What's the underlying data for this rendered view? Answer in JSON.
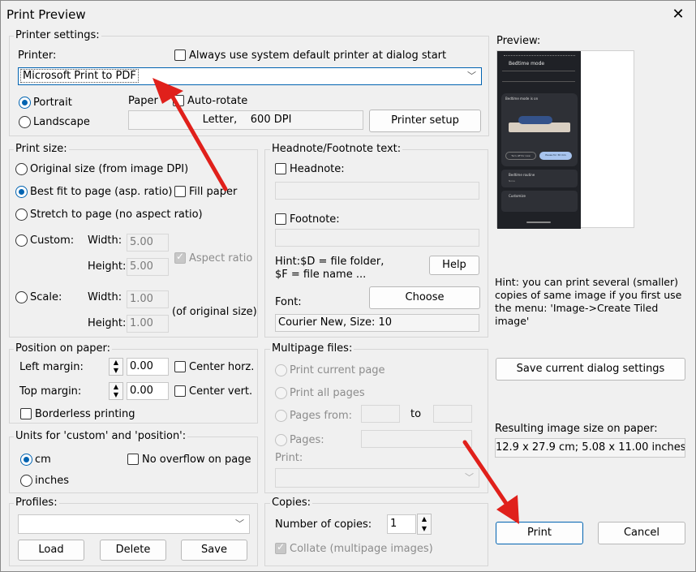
{
  "window": {
    "title": "Print Preview",
    "close_glyph": "✕"
  },
  "printer_settings": {
    "group_label": "Printer settings:",
    "printer_label": "Printer:",
    "always_default_label": "Always use system default printer at dialog start",
    "printer_value": "Microsoft Print to PDF",
    "portrait_label": "Portrait",
    "landscape_label": "Landscape",
    "paper_label": "Paper",
    "auto_rotate_label": "Auto-rotate",
    "paper_value": "Letter,    600 DPI",
    "printer_setup_label": "Printer setup"
  },
  "print_size": {
    "group_label": "Print size:",
    "original_label": "Original size (from image DPI)",
    "best_fit_label": "Best fit to page (asp. ratio)",
    "fill_paper_label": "Fill paper",
    "stretch_label": "Stretch to page (no aspect ratio)",
    "custom_label": "Custom:",
    "width_label": "Width:",
    "height_label": "Height:",
    "custom_width": "5.00",
    "custom_height": "5.00",
    "aspect_ratio_label": "Aspect ratio",
    "scale_label": "Scale:",
    "scale_width": "1.00",
    "scale_height": "1.00",
    "of_original_label": "(of original size)"
  },
  "position": {
    "group_label": "Position on paper:",
    "left_margin_label": "Left margin:",
    "left_margin_value": "0.00",
    "center_horz_label": "Center horz.",
    "top_margin_label": "Top margin:",
    "top_margin_value": "0.00",
    "center_vert_label": "Center vert.",
    "borderless_label": "Borderless printing"
  },
  "units": {
    "group_label": "Units for 'custom' and 'position':",
    "cm_label": "cm",
    "inches_label": "inches",
    "no_overflow_label": "No overflow on page"
  },
  "profiles": {
    "group_label": "Profiles:",
    "load_label": "Load",
    "delete_label": "Delete",
    "save_label": "Save"
  },
  "headnote": {
    "group_label": "Headnote/Footnote text:",
    "headnote_label": "Headnote:",
    "footnote_label": "Footnote:",
    "hint_line1": "Hint:$D = file folder,",
    "hint_line2": "$F = file name ...",
    "help_label": "Help",
    "font_label": "Font:",
    "choose_label": "Choose",
    "font_value": "Courier New, Size: 10"
  },
  "multipage": {
    "group_label": "Multipage files:",
    "print_current_label": "Print current page",
    "print_all_label": "Print all pages",
    "pages_from_label": "Pages from:",
    "to_label": "to",
    "pages_label": "Pages:",
    "print_label": "Print:"
  },
  "copies": {
    "group_label": "Copies:",
    "number_label": "Number of copies:",
    "number_value": "1",
    "collate_label": "Collate (multipage images)"
  },
  "preview": {
    "label": "Preview:",
    "phone_title": "Bedtime mode",
    "phone_status": "Bedtime mode is on",
    "phone_btn1": "Turn off for now",
    "phone_btn2": "Pause for 30 min",
    "phone_row1": "Bedtime routine",
    "phone_row1_sub": "None",
    "phone_row2": "Customize",
    "hint": "Hint: you can print several (smaller) copies of same image if you first use the menu: 'Image->Create Tiled image'"
  },
  "right": {
    "save_settings_label": "Save current dialog settings",
    "result_label": "Resulting image size on paper:",
    "result_value": "12.9 x 27.9 cm; 5.08 x 11.00 inches",
    "print_label": "Print",
    "cancel_label": "Cancel"
  },
  "colors": {
    "accent": "#0063b1",
    "annotation_arrow": "#e0201b"
  }
}
